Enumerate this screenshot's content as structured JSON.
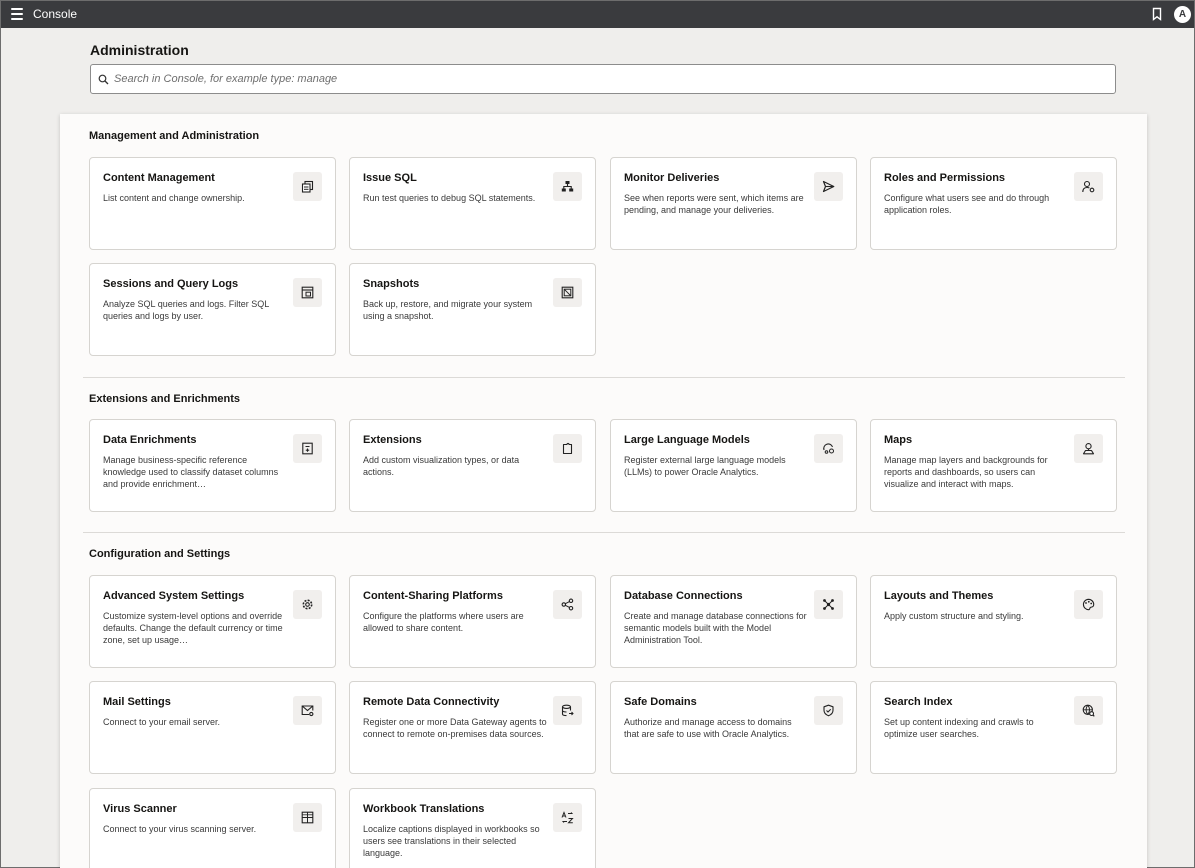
{
  "header": {
    "app_title": "Console",
    "avatar_initial": "A"
  },
  "page": {
    "title": "Administration",
    "search_placeholder": "Search in Console, for example type: manage"
  },
  "sections": [
    {
      "title": "Management and Administration",
      "cards": [
        {
          "title": "Content Management",
          "desc": "List content and change ownership.",
          "icon": "content-pages-icon"
        },
        {
          "title": "Issue SQL",
          "desc": "Run test queries to debug SQL statements.",
          "icon": "hierarchy-icon"
        },
        {
          "title": "Monitor Deliveries",
          "desc": "See when reports were sent, which items are pending, and manage your deliveries.",
          "icon": "send-icon"
        },
        {
          "title": "Roles and Permissions",
          "desc": "Configure what users see and do through application roles.",
          "icon": "user-settings-icon"
        },
        {
          "title": "Sessions and Query Logs",
          "desc": "Analyze SQL queries and logs. Filter SQL queries and logs by user.",
          "icon": "log-window-icon"
        },
        {
          "title": "Snapshots",
          "desc": "Back up, restore, and migrate your system using a snapshot.",
          "icon": "snapshot-icon"
        }
      ]
    },
    {
      "title": "Extensions and Enrichments",
      "cards": [
        {
          "title": "Data Enrichments",
          "desc": "Manage business-specific reference knowledge used to classify dataset columns and provide enrichment…",
          "icon": "enrichment-icon"
        },
        {
          "title": "Extensions",
          "desc": "Add custom visualization types, or data actions.",
          "icon": "extension-icon"
        },
        {
          "title": "Large Language Models",
          "desc": "Register external large language models (LLMs) to power Oracle Analytics.",
          "icon": "llm-icon"
        },
        {
          "title": "Maps",
          "desc": "Manage map layers and backgrounds for reports and dashboards, so users can visualize and interact with maps.",
          "icon": "map-pin-icon"
        }
      ]
    },
    {
      "title": "Configuration and Settings",
      "cards": [
        {
          "title": "Advanced System Settings",
          "desc": "Customize system-level options and override defaults. Change the default currency or time zone, set up usage…",
          "icon": "gear-icon"
        },
        {
          "title": "Content-Sharing Platforms",
          "desc": "Configure the platforms where users are allowed to share content.",
          "icon": "share-icon"
        },
        {
          "title": "Database Connections",
          "desc": "Create and manage database connections for semantic models built with the Model Administration Tool.",
          "icon": "network-icon"
        },
        {
          "title": "Layouts and Themes",
          "desc": "Apply custom structure and styling.",
          "icon": "palette-icon"
        },
        {
          "title": "Mail Settings",
          "desc": "Connect to your email server.",
          "icon": "mail-settings-icon"
        },
        {
          "title": "Remote Data Connectivity",
          "desc": "Register one or more Data Gateway agents to connect to remote on-premises data sources.",
          "icon": "database-icon"
        },
        {
          "title": "Safe Domains",
          "desc": "Authorize and manage access to domains that are safe to use with Oracle Analytics.",
          "icon": "shield-check-icon"
        },
        {
          "title": "Search Index",
          "desc": "Set up content indexing and crawls to optimize user searches.",
          "icon": "globe-search-icon"
        },
        {
          "title": "Virus Scanner",
          "desc": "Connect to your virus scanning server.",
          "icon": "scanner-grid-icon"
        },
        {
          "title": "Workbook Translations",
          "desc": "Localize captions displayed in workbooks so users see translations in their selected language.",
          "icon": "translate-icon"
        }
      ]
    }
  ]
}
